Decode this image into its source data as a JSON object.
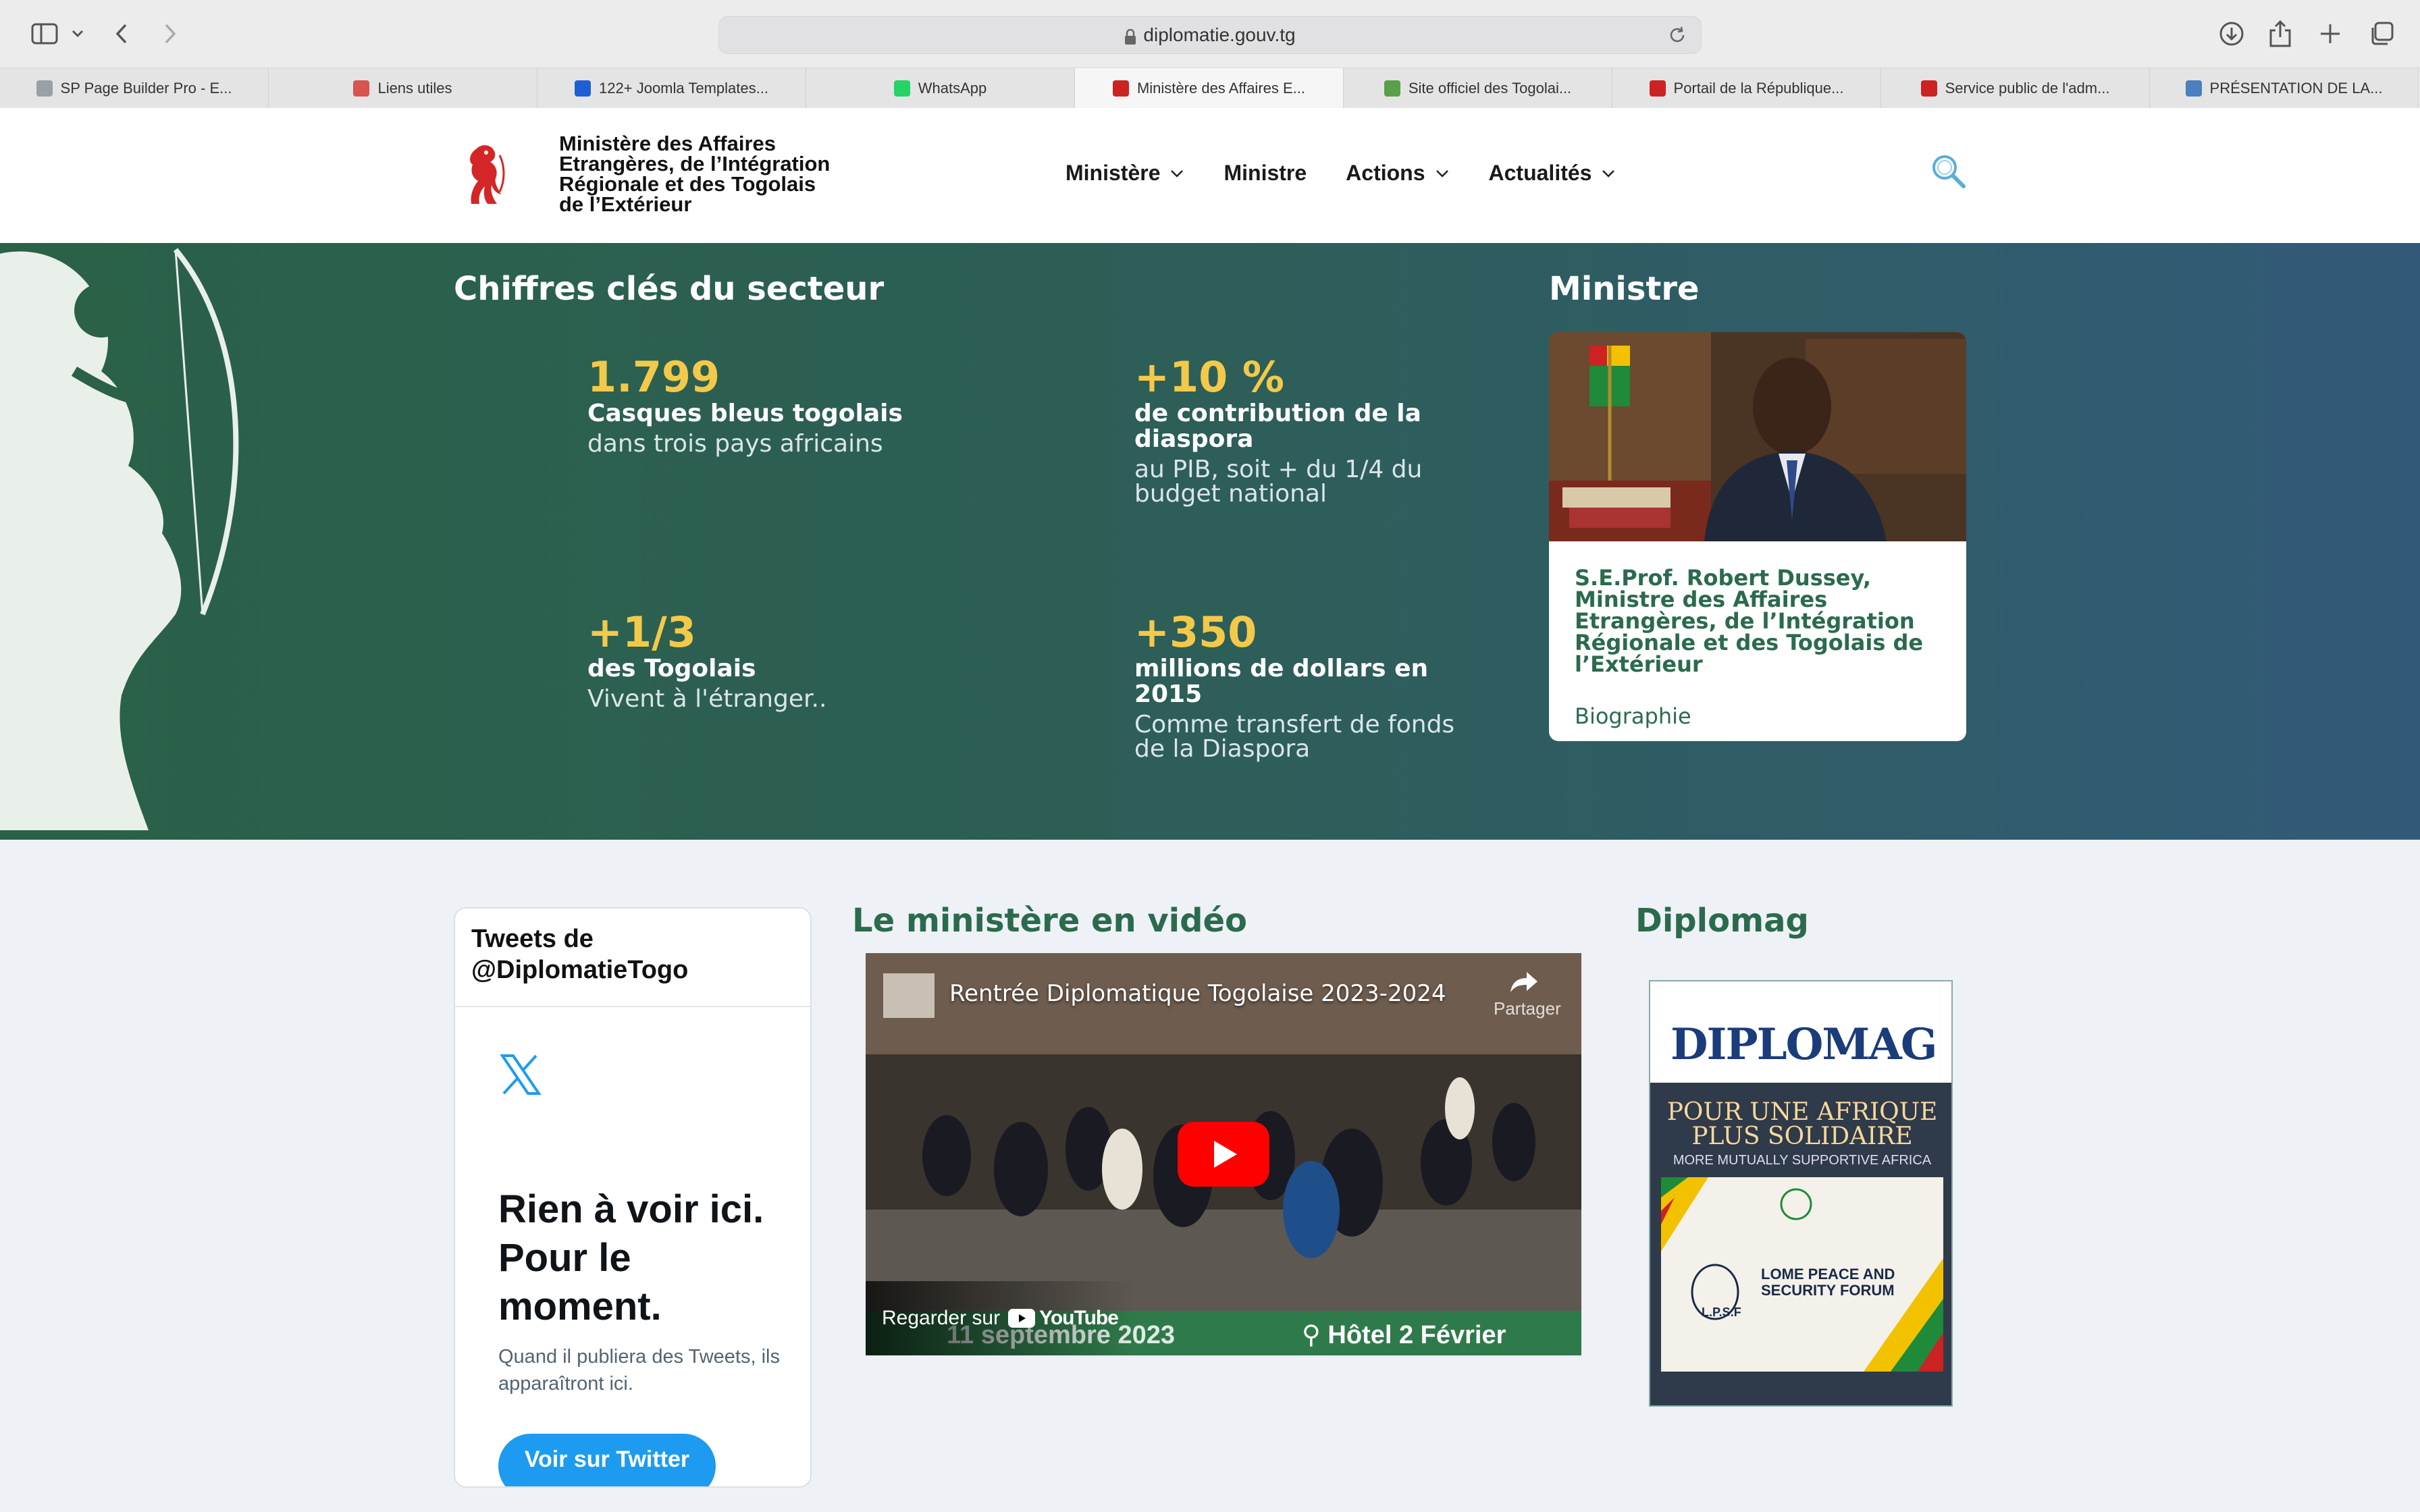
{
  "browser": {
    "url": "diplomatie.gouv.tg",
    "tabs": [
      {
        "label": "SP Page Builder Pro - E...",
        "fav": "#9aa0a6",
        "active": false
      },
      {
        "label": "Liens utiles",
        "fav": "#d9534f",
        "active": false
      },
      {
        "label": "122+ Joomla Templates...",
        "fav": "#1f5fd6",
        "active": false
      },
      {
        "label": "WhatsApp",
        "fav": "#25d366",
        "active": false
      },
      {
        "label": "Ministère des Affaires E...",
        "fav": "#cc2222",
        "active": true
      },
      {
        "label": "Site officiel des Togolai...",
        "fav": "#5aa04a",
        "active": false
      },
      {
        "label": "Portail de la République...",
        "fav": "#cc2222",
        "active": false
      },
      {
        "label": "Service public de l'adm...",
        "fav": "#cc2222",
        "active": false
      },
      {
        "label": "PRÉSENTATION DE LA...",
        "fav": "#4a7fc0",
        "active": false
      }
    ]
  },
  "header": {
    "logo_text": "Ministère des Affaires Etrangères, de l’Intégration Régionale et des Togolais de l’Extérieur",
    "nav": [
      {
        "label": "Ministère",
        "dropdown": true
      },
      {
        "label": "Ministre",
        "dropdown": false
      },
      {
        "label": "Actions",
        "dropdown": true
      },
      {
        "label": "Actualités",
        "dropdown": true
      }
    ],
    "search_icon": "search-icon"
  },
  "hero": {
    "stats_heading": "Chiffres clés du secteur",
    "stats": [
      {
        "num": "1.799",
        "label": "Casques bleus togolais",
        "sub": "dans trois pays africains"
      },
      {
        "num": "+10 %",
        "label": "de contribution de la diaspora",
        "sub": "au PIB, soit + du 1/4 du budget national"
      },
      {
        "num": "+1/3",
        "label": "des Togolais",
        "sub": "Vivent à l'étranger.."
      },
      {
        "num": "+350",
        "label": "millions de dollars en 2015",
        "sub": "Comme transfert de fonds de la Diaspora"
      }
    ],
    "minister_heading": "Ministre",
    "minister_name": "S.E.Prof. Robert Dussey, Ministre des Affaires Etrangères, de l’Intégration Régionale et des Togolais de l’Extérieur",
    "minister_link": "Biographie"
  },
  "tweets": {
    "title": "Tweets de @DiplomatieTogo",
    "empty_heading": "Rien à voir ici. Pour le moment.",
    "empty_sub": "Quand il publiera des Tweets, ils apparaîtront ici.",
    "button": "Voir sur Twitter"
  },
  "video": {
    "section_title": "Le ministère en vidéo",
    "title": "Rentrée Diplomatique Togolaise 2023-2024",
    "share": "Partager",
    "watch_on": "Regarder sur",
    "youtube": "YouTube",
    "date": "11 septembre 2023",
    "place": "Hôtel 2 Février"
  },
  "diplomag": {
    "section_title": "Diplomag",
    "logo": "DIPLOMAG",
    "headline": "POUR UNE AFRIQUE PLUS SOLIDAIRE",
    "subheadline": "MORE MUTUALLY SUPPORTIVE AFRICA",
    "forum": "LOME PEACE AND SECURITY FORUM",
    "lpsf": "L.P.S.F"
  }
}
